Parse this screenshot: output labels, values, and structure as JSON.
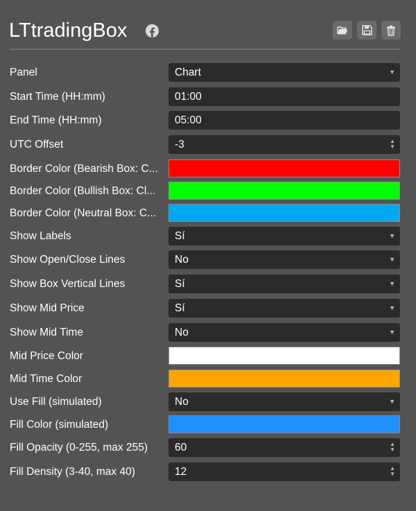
{
  "header": {
    "title": "LTtradingBox",
    "icons": {
      "facebook": "facebook-icon",
      "open": "folder-open-icon",
      "save": "floppy-disk-icon",
      "delete": "trash-icon"
    }
  },
  "settings": [
    {
      "label": "Panel",
      "kind": "select",
      "value": "Chart"
    },
    {
      "label": "Start Time (HH:mm)",
      "kind": "text",
      "value": "01:00"
    },
    {
      "label": "End Time (HH:mm)",
      "kind": "text",
      "value": "05:00"
    },
    {
      "label": "UTC Offset",
      "kind": "number",
      "value": "-3"
    },
    {
      "label": "Border Color (Bearish Box: C...",
      "kind": "color",
      "color": "#ff0000"
    },
    {
      "label": "Border Color (Bullish Box: Cl...",
      "kind": "color",
      "color": "#00ff00"
    },
    {
      "label": "Border Color (Neutral Box: C...",
      "kind": "color",
      "color": "#00a8f0"
    },
    {
      "label": "Show Labels",
      "kind": "select",
      "value": "Sí"
    },
    {
      "label": "Show Open/Close Lines",
      "kind": "select",
      "value": "No"
    },
    {
      "label": "Show Box Vertical Lines",
      "kind": "select",
      "value": "Sí"
    },
    {
      "label": "Show Mid Price",
      "kind": "select",
      "value": "Sí"
    },
    {
      "label": "Show Mid Time",
      "kind": "select",
      "value": "No"
    },
    {
      "label": "Mid Price Color",
      "kind": "color",
      "color": "#ffffff"
    },
    {
      "label": "Mid Time Color",
      "kind": "color",
      "color": "#ffa500"
    },
    {
      "label": "Use Fill (simulated)",
      "kind": "select",
      "value": "No"
    },
    {
      "label": "Fill Color (simulated)",
      "kind": "color",
      "color": "#1e90ff"
    },
    {
      "label": "Fill Opacity (0-255, max 255)",
      "kind": "number",
      "value": "60"
    },
    {
      "label": "Fill Density (3-40, max 40)",
      "kind": "number",
      "value": "12"
    }
  ]
}
